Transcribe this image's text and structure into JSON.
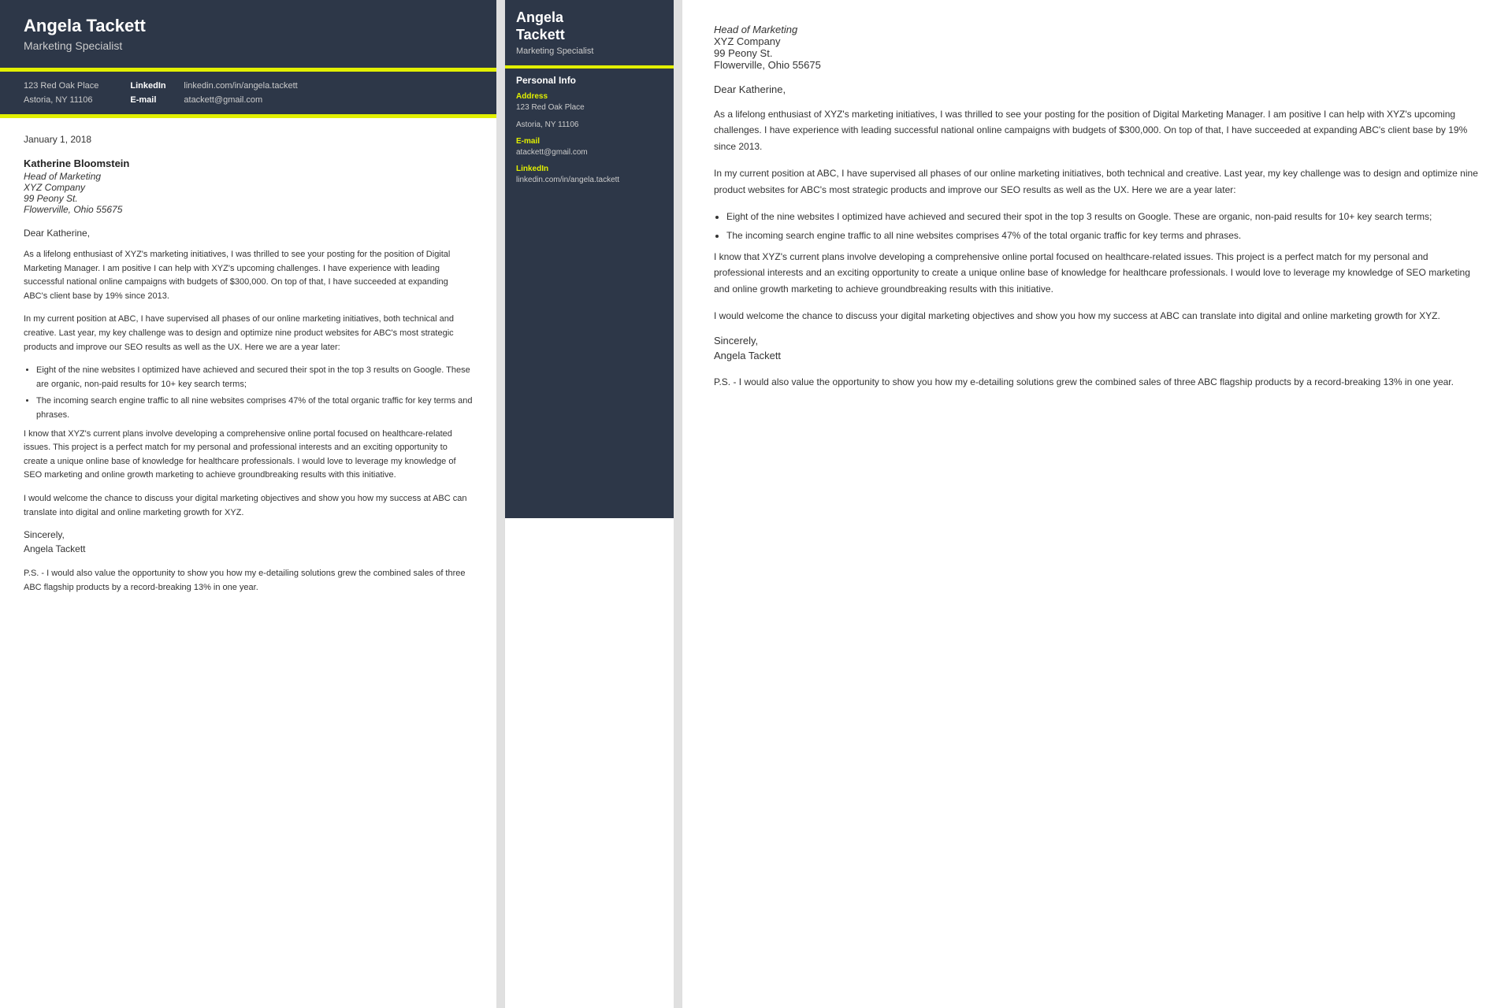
{
  "left": {
    "header": {
      "name": "Angela Tackett",
      "title": "Marketing Specialist"
    },
    "contact": {
      "address_line1": "123 Red Oak Place",
      "address_line2": "Astoria, NY 11106",
      "linkedin_label": "LinkedIn",
      "linkedin_value": "linkedin.com/in/angela.tackett",
      "email_label": "E-mail",
      "email_value": "atackett@gmail.com"
    },
    "date": "January 1, 2018",
    "recipient": {
      "name": "Katherine Bloomstein",
      "title_line1": "Head of Marketing",
      "company": "XYZ Company",
      "address1": "99 Peony St.",
      "address2": "Flowerville, Ohio 55675"
    },
    "salutation": "Dear Katherine,",
    "paragraphs": [
      "As a lifelong enthusiast of XYZ's marketing initiatives, I was thrilled to see your posting for the position of Digital Marketing Manager. I am positive I can help with XYZ's upcoming challenges. I have experience with leading successful national online campaigns with budgets of $300,000. On top of that, I have succeeded at expanding ABC's client base by 19% since 2013.",
      "In my current position at ABC, I have supervised all phases of our online marketing initiatives, both technical and creative. Last year, my key challenge was to design and optimize nine product websites for ABC's most strategic products and improve our SEO results as well as the UX. Here we are a year later:",
      "I know that XYZ's current plans involve developing a comprehensive online portal focused on healthcare-related issues. This project is a perfect match for my personal and professional interests and an exciting opportunity to create a unique online base of knowledge for healthcare professionals. I would love to leverage my knowledge of SEO marketing and online growth marketing to achieve groundbreaking results with this initiative.",
      "I would welcome the chance to discuss your digital marketing objectives and show you how my success at ABC can translate into digital and online marketing growth for XYZ."
    ],
    "bullets": [
      "Eight of the nine websites I optimized have achieved and secured their spot in the top 3 results on Google. These are organic, non-paid results for 10+ key search terms;",
      "The incoming search engine traffic to all nine websites comprises 47% of the total organic traffic for key terms and phrases."
    ],
    "closing": "Sincerely,",
    "signature": "Angela Tackett",
    "ps": "P.S. - I would also value the opportunity to show you how my e-detailing solutions grew the combined sales of three ABC flagship products by a record-breaking 13% in one year."
  },
  "middle": {
    "name_line1": "Angela",
    "name_line2": "Tackett",
    "title": "Marketing Specialist",
    "section_title": "Personal Info",
    "address_label": "Address",
    "address_value1": "123 Red Oak Place",
    "address_value2": "Astoria, NY 11106",
    "email_label": "E-mail",
    "email_value": "atackett@gmail.com",
    "linkedin_label": "LinkedIn",
    "linkedin_value": "linkedin.com/in/angela.tackett"
  },
  "right": {
    "recipient_name": "Head of Marketing",
    "recipient_company": "XYZ Company",
    "recipient_address1": "99 Peony St.",
    "recipient_address2": "Flowerville, Ohio 55675",
    "salutation": "Dear Katherine,",
    "paragraphs": [
      "As a lifelong enthusiast of XYZ's marketing initiatives, I was thrilled to see your posting for the position of Digital Marketing Manager. I am positive I can help with XYZ's upcoming challenges. I have experience with leading successful national online campaigns with budgets of $300,000. On top of that, I have succeeded at expanding ABC's client base by 19% since 2013.",
      "In my current position at ABC, I have supervised all phases of our online marketing initiatives, both technical and creative. Last year, my key challenge was to design and optimize nine product websites for ABC's most strategic products and improve our SEO results as well as the UX. Here we are a year later:",
      "I know that XYZ's current plans involve developing a comprehensive online portal focused on healthcare-related issues. This project is a perfect match for my personal and professional interests and an exciting opportunity to create a unique online base of knowledge for healthcare professionals. I would love to leverage my knowledge of SEO marketing and online growth marketing to achieve groundbreaking results with this initiative.",
      "I would welcome the chance to discuss your digital marketing objectives and show you how my success at ABC can translate into digital and online marketing growth for XYZ."
    ],
    "bullets": [
      "Eight of the nine websites I optimized have achieved and secured their spot in the top 3 results on Google. These are organic, non-paid results for 10+ key search terms;",
      "The incoming search engine traffic to all nine websites comprises 47% of the total organic traffic for key terms and phrases."
    ],
    "closing": "Sincerely,",
    "signature": "Angela Tackett",
    "ps": "P.S. - I would also value the opportunity to show you how my e-detailing solutions grew the combined sales of three ABC flagship products by a record-breaking 13% in one year."
  }
}
